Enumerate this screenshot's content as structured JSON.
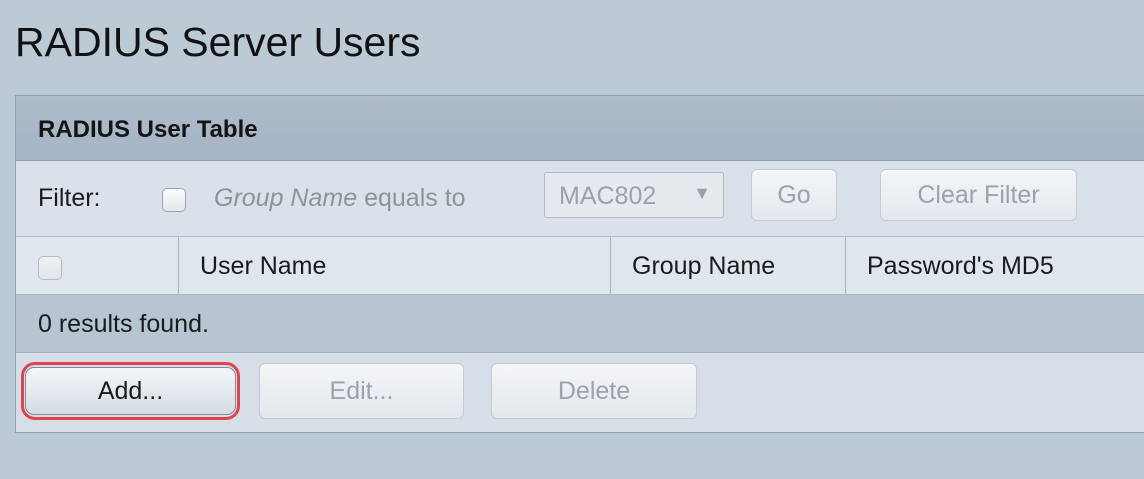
{
  "page": {
    "title": "RADIUS Server Users"
  },
  "table": {
    "title": "RADIUS User Table",
    "filter": {
      "label": "Filter:",
      "field_name": "Group Name",
      "operator_text": "equals to",
      "select_value": "MAC802",
      "go_label": "Go",
      "clear_label": "Clear Filter"
    },
    "columns": [
      "User Name",
      "Group Name",
      "Password's MD5"
    ],
    "results_text": "0 results found.",
    "actions": {
      "add_label": "Add...",
      "edit_label": "Edit...",
      "delete_label": "Delete"
    }
  },
  "colors": {
    "highlight": "#e0454d",
    "header_bg": "#aebccc",
    "results_bg": "#b7c4d2"
  }
}
